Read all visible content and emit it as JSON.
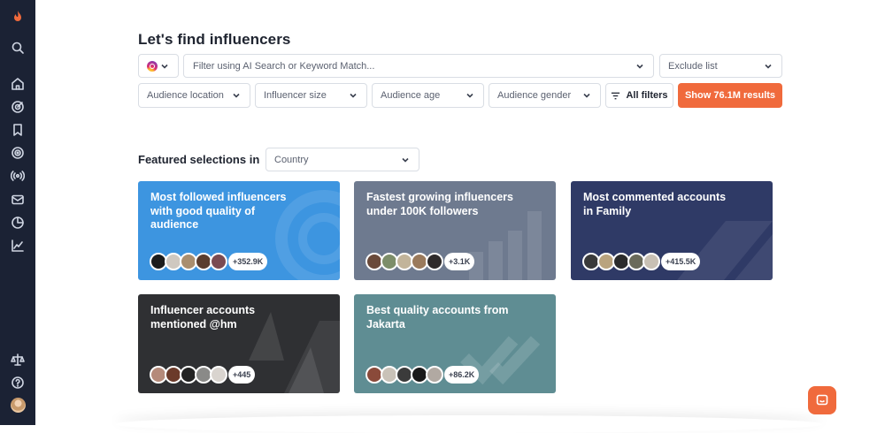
{
  "page": {
    "title": "Let's find influencers"
  },
  "sidebar": {
    "icons": [
      "logo-flame-icon",
      "search-icon",
      "home-icon",
      "discover-icon",
      "bookmark-icon",
      "target-icon",
      "broadcast-icon",
      "mail-icon",
      "pie-chart-icon",
      "trend-icon",
      "scale-icon",
      "help-icon",
      "avatar"
    ]
  },
  "search": {
    "platform_icon": "instagram-icon",
    "placeholder": "Filter using AI Search or Keyword Match...",
    "exclude_label": "Exclude list"
  },
  "filters": {
    "audience_location": "Audience location",
    "influencer_size": "Influencer size",
    "audience_age": "Audience age",
    "audience_gender": "Audience gender",
    "all_filters": "All filters",
    "show_results": "Show 76.1M results"
  },
  "featured": {
    "label": "Featured selections in",
    "country_placeholder": "Country",
    "cards": [
      {
        "title": "Most followed influencers with good quality of audience",
        "count": "+352.9K",
        "color": "#3d95e0"
      },
      {
        "title": "Fastest growing influencers under 100K followers",
        "count": "+3.1K",
        "color": "#6e7a8f"
      },
      {
        "title": "Most commented accounts in Family",
        "count": "+415.5K",
        "color": "#2f3a66"
      },
      {
        "title": "Influencer accounts mentioned @hm",
        "count": "+445",
        "color": "#2f3033"
      },
      {
        "title": "Best quality accounts from Jakarta",
        "count": "+86.2K",
        "color": "#5f8d93"
      }
    ]
  },
  "colors": {
    "accent": "#f06a3c",
    "sidebar": "#1b2234"
  },
  "chat": {
    "icon": "chat-icon"
  }
}
